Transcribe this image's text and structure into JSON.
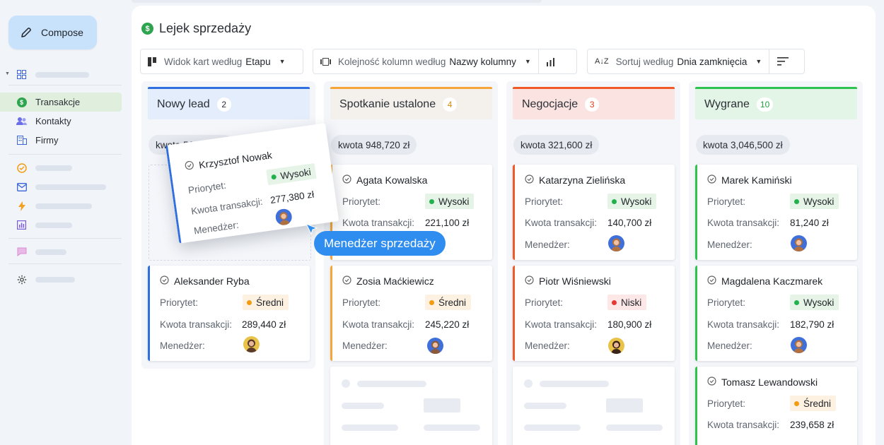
{
  "sidebar": {
    "compose_label": "Compose",
    "items": [
      {
        "label": "Transakcje",
        "icon": "dollar-icon",
        "active": true
      },
      {
        "label": "Kontakty",
        "icon": "contacts-icon"
      },
      {
        "label": "Firmy",
        "icon": "building-icon"
      }
    ]
  },
  "page": {
    "title": "Lejek sprzedaży"
  },
  "toolbar": {
    "view_label": "Widok kart według",
    "view_value": "Etapu",
    "order_label": "Kolejność kolumn według",
    "order_value": "Nazwy kolumny",
    "sort_label": "Sortuj według",
    "sort_value": "Dnia zamknięcia"
  },
  "labels": {
    "priority": "Priorytet:",
    "amount": "Kwota transakcji:",
    "manager": "Menedżer:"
  },
  "priorities": {
    "high": "Wysoki",
    "medium": "Średni",
    "low": "Niski"
  },
  "columns": [
    {
      "name": "Nowy lead",
      "count": "2",
      "sum": "kwota 566,640 zł",
      "color": "#2f6fe0",
      "head_bg": "#e3edfb",
      "cards": [
        {
          "name": "Aleksander Ryba",
          "priority": "Średni",
          "amount": "289,440 zł"
        }
      ]
    },
    {
      "name": "Spotkanie ustalone",
      "count": "4",
      "sum": "kwota 948,720 zł",
      "color": "#f5a53a",
      "head_bg": "#f4f1ec",
      "cards": [
        {
          "name": "Agata Kowalska",
          "priority": "Wysoki",
          "amount": "221,100 zł"
        },
        {
          "name": "Zosia Maćkiewicz",
          "priority": "Średni",
          "amount": "245,220 zł"
        }
      ]
    },
    {
      "name": "Negocjacje",
      "count": "3",
      "sum": "kwota 321,600 zł",
      "color": "#f05a28",
      "head_bg": "#fbe3e1",
      "cards": [
        {
          "name": "Katarzyna Zielińska",
          "priority": "Wysoki",
          "amount": "140,700 zł"
        },
        {
          "name": "Piotr Wiśniewski",
          "priority": "Niski",
          "amount": "180,900 zł"
        }
      ]
    },
    {
      "name": "Wygrane",
      "count": "10",
      "sum": "kwota 3,046,500 zł",
      "color": "#2ec24f",
      "head_bg": "#e3f5e6",
      "cards": [
        {
          "name": "Marek Kamiński",
          "priority": "Wysoki",
          "amount": "81,240 zł"
        },
        {
          "name": "Magdalena Kaczmarek",
          "priority": "Wysoki",
          "amount": "182,790 zł"
        },
        {
          "name": "Tomasz Lewandowski",
          "priority": "Średni",
          "amount": "239,658 zł"
        }
      ]
    }
  ],
  "dragged_card": {
    "name": "Krzysztof Nowak",
    "priority": "Wysoki",
    "amount": "277,380 zł"
  },
  "tooltip": "Menedżer sprzedaży"
}
